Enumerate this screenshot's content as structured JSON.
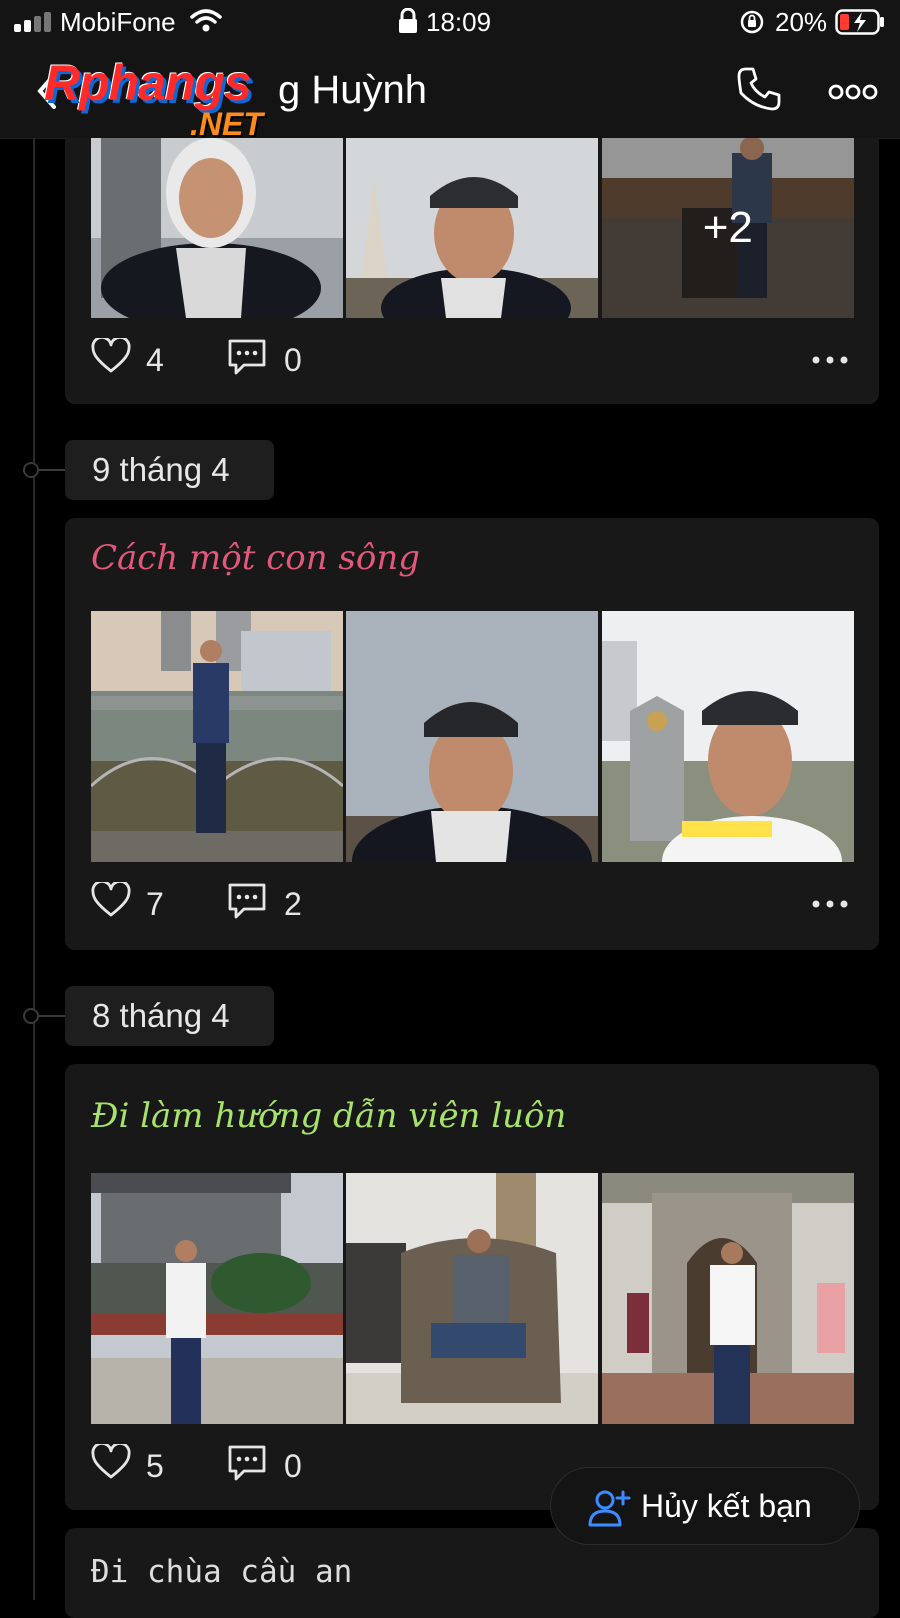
{
  "status_bar": {
    "carrier": "MobiFone",
    "time": "18:09",
    "battery": "20%"
  },
  "header": {
    "title": "g Huỳnh",
    "logo_main": "Rphangs",
    "logo_sub": ".NET"
  },
  "posts": [
    {
      "caption": "",
      "likes": "4",
      "comments": "0",
      "extra_photos": "+2"
    },
    {
      "date": "9 tháng 4",
      "caption": "Cách một con sông",
      "caption_color": "#e2587a",
      "likes": "7",
      "comments": "2"
    },
    {
      "date": "8 tháng 4",
      "caption": "Đi làm hướng dẫn viên luôn",
      "caption_color": "#a6e36a",
      "likes": "5",
      "comments": "0"
    },
    {
      "caption": "Đi chùa cầu an"
    }
  ],
  "fab": {
    "label": "Hủy kết bạn"
  },
  "icons": [
    "signal-icon",
    "wifi-icon",
    "lock-icon",
    "rotation-lock-icon",
    "battery-icon",
    "back-icon",
    "phone-icon",
    "more-icon",
    "heart-icon",
    "comment-icon",
    "dots-icon",
    "add-friend-icon"
  ]
}
